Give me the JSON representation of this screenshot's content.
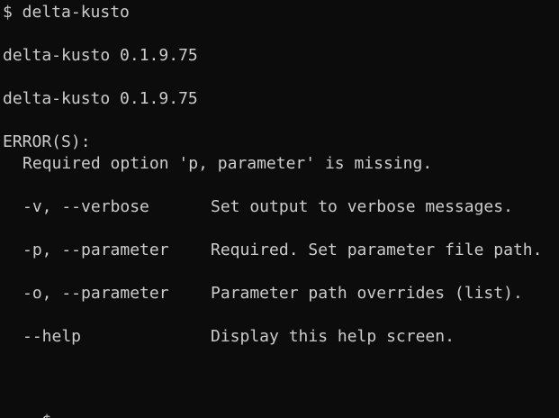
{
  "terminal": {
    "prompt_command": "$ delta-kusto",
    "version_line_1": "delta-kusto 0.1.9.75",
    "version_line_2": "delta-kusto 0.1.9.75",
    "error_header": "ERROR(S):",
    "error_message": "Required option 'p, parameter' is missing.",
    "options": [
      {
        "flag": "-v, --verbose",
        "description": "Set output to verbose messages."
      },
      {
        "flag": "-p, --parameter",
        "description": "Required. Set parameter file path."
      },
      {
        "flag": "-o, --parameter",
        "description": "Parameter path overrides (list)."
      },
      {
        "flag": "--help",
        "description": "Display this help screen."
      }
    ],
    "final_prompt": "$"
  },
  "colors": {
    "background": "#0c0c0c",
    "text": "#cccccc"
  }
}
